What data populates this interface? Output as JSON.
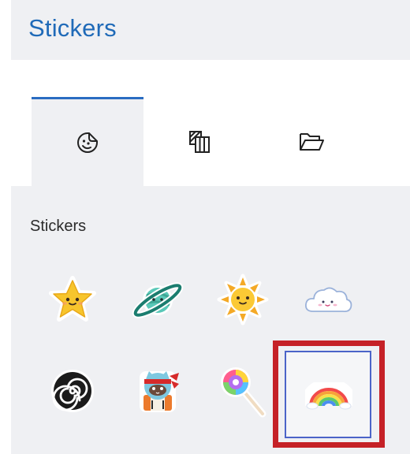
{
  "header": {
    "title": "Stickers"
  },
  "tabs": [
    {
      "icon": "sticker-smiley-icon",
      "active": true
    },
    {
      "icon": "textures-icon",
      "active": false
    },
    {
      "icon": "folder-open-icon",
      "active": false
    }
  ],
  "panel": {
    "title": "Stickers",
    "stickers": [
      {
        "icon": "star-sticker-icon"
      },
      {
        "icon": "planet-sticker-icon"
      },
      {
        "icon": "sun-sticker-icon"
      },
      {
        "icon": "cloud-sticker-icon"
      },
      {
        "icon": "spiral-sticker-icon"
      },
      {
        "icon": "ninja-cat-sticker-icon"
      },
      {
        "icon": "lollipop-sticker-icon"
      },
      {
        "icon": "rainbow-sticker-icon",
        "selected": true
      }
    ]
  },
  "colors": {
    "accent": "#1f6ab8",
    "selection_outer": "#c52127",
    "selection_inner": "#4b64c8",
    "panel_bg": "#eff0f3"
  }
}
